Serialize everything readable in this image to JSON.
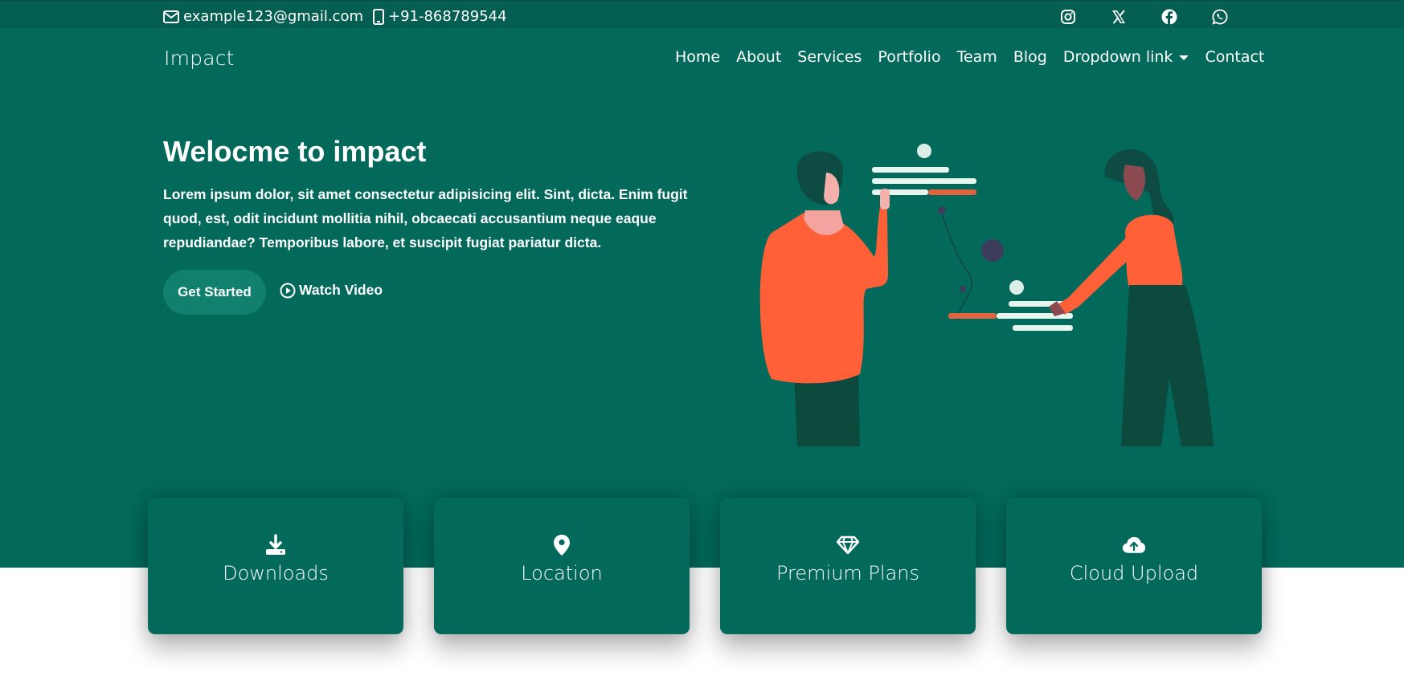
{
  "topbar": {
    "email": "example123@gmail.com",
    "phone": "+91-868789544",
    "socials": [
      "instagram-icon",
      "x-icon",
      "facebook-icon",
      "whatsapp-icon"
    ]
  },
  "navbar": {
    "brand": "Impact",
    "links": [
      "Home",
      "About",
      "Services",
      "Portfolio",
      "Team",
      "Blog",
      "Dropdown link",
      "Contact"
    ]
  },
  "hero": {
    "title": "Welocme to impact",
    "lead": "Lorem ipsum dolor, sit amet consectetur adipisicing elit. Sint, dicta. Enim fugit quod, est, odit incidunt mollitia nihil, obcaecati accusantium neque eaque repudiandae? Temporibus labore, et suscipit fugiat pariatur dicta.",
    "primary_button": "Get Started",
    "video_button": "Watch Video"
  },
  "cards": [
    {
      "label": "Downloads",
      "icon": "download-icon"
    },
    {
      "label": "Location",
      "icon": "location-pin-icon"
    },
    {
      "label": "Premium Plans",
      "icon": "gem-icon"
    },
    {
      "label": "Cloud Upload",
      "icon": "cloud-upload-icon"
    }
  ],
  "colors": {
    "primary": "#02695b",
    "topbar": "#055e52",
    "button": "#11806e",
    "accent_orange": "#ff6037"
  }
}
